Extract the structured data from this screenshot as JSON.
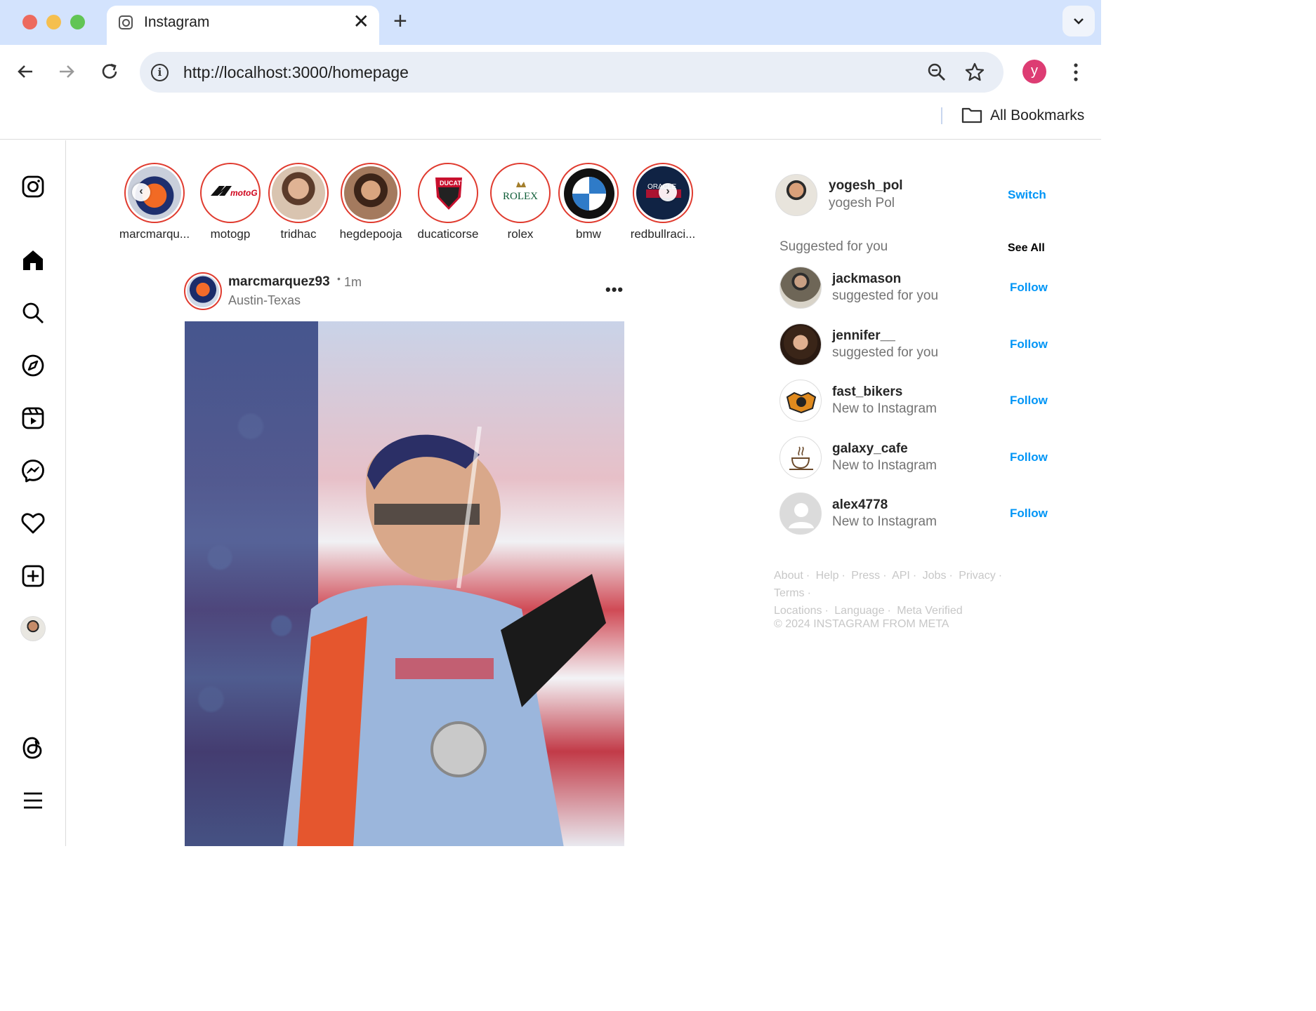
{
  "browser": {
    "tab_title": "Instagram",
    "tab_close": "✕",
    "new_tab": "+",
    "url": "http://localhost:3000/homepage",
    "profile_initial": "y",
    "bookmarks_label": "All Bookmarks"
  },
  "sidebar": {
    "items": [
      {
        "icon": "instagram-icon"
      },
      {
        "icon": "home-icon"
      },
      {
        "icon": "search-icon"
      },
      {
        "icon": "explore-icon"
      },
      {
        "icon": "reels-icon"
      },
      {
        "icon": "messenger-icon"
      },
      {
        "icon": "heart-icon"
      },
      {
        "icon": "create-icon"
      },
      {
        "icon": "profile-avatar"
      },
      {
        "icon": "threads-icon"
      },
      {
        "icon": "menu-icon"
      }
    ]
  },
  "stories": [
    {
      "name": "marcmarqu...",
      "color": "#d2542a"
    },
    {
      "name": "motogp",
      "color": "#ffffff"
    },
    {
      "name": "tridhac",
      "color": "#c89d7e"
    },
    {
      "name": "hegdepooja",
      "color": "#b8876a"
    },
    {
      "name": "ducaticorse",
      "color": "#ffffff"
    },
    {
      "name": "rolex",
      "color": "#ffffff"
    },
    {
      "name": "bmw",
      "color": "#ffffff"
    },
    {
      "name": "redbullraci...",
      "color": "#102344"
    }
  ],
  "post": {
    "username": "marcmarquez93",
    "dot": "•",
    "time": "1m",
    "location": "Austin-Texas",
    "more": "•••"
  },
  "me": {
    "username": "yogesh_pol",
    "name": "yogesh Pol",
    "switch_label": "Switch"
  },
  "suggestions": {
    "title": "Suggested for you",
    "see_all": "See All",
    "items": [
      {
        "username": "jackmason",
        "subtitle": "suggested for you",
        "action": "Follow"
      },
      {
        "username": "jennifer__",
        "subtitle": "suggested for you",
        "action": "Follow"
      },
      {
        "username": "fast_bikers",
        "subtitle": "New to Instagram",
        "action": "Follow"
      },
      {
        "username": "galaxy_cafe",
        "subtitle": "New to Instagram",
        "action": "Follow"
      },
      {
        "username": "alex4778",
        "subtitle": "New to Instagram",
        "action": "Follow"
      }
    ]
  },
  "footer": {
    "links": [
      "About",
      "·",
      "Help",
      "·",
      "Press",
      "·",
      "API",
      "·",
      "Jobs",
      "·",
      "Privacy",
      "·",
      "Terms",
      "·",
      "Locations",
      "·",
      "Language",
      "·",
      "Meta Verified"
    ],
    "copyright": "© 2024 INSTAGRAM FROM META"
  },
  "colors": {
    "link_blue": "#0095f6",
    "story_ring": "#e03b2f",
    "tabstrip": "#d3e3fd"
  }
}
